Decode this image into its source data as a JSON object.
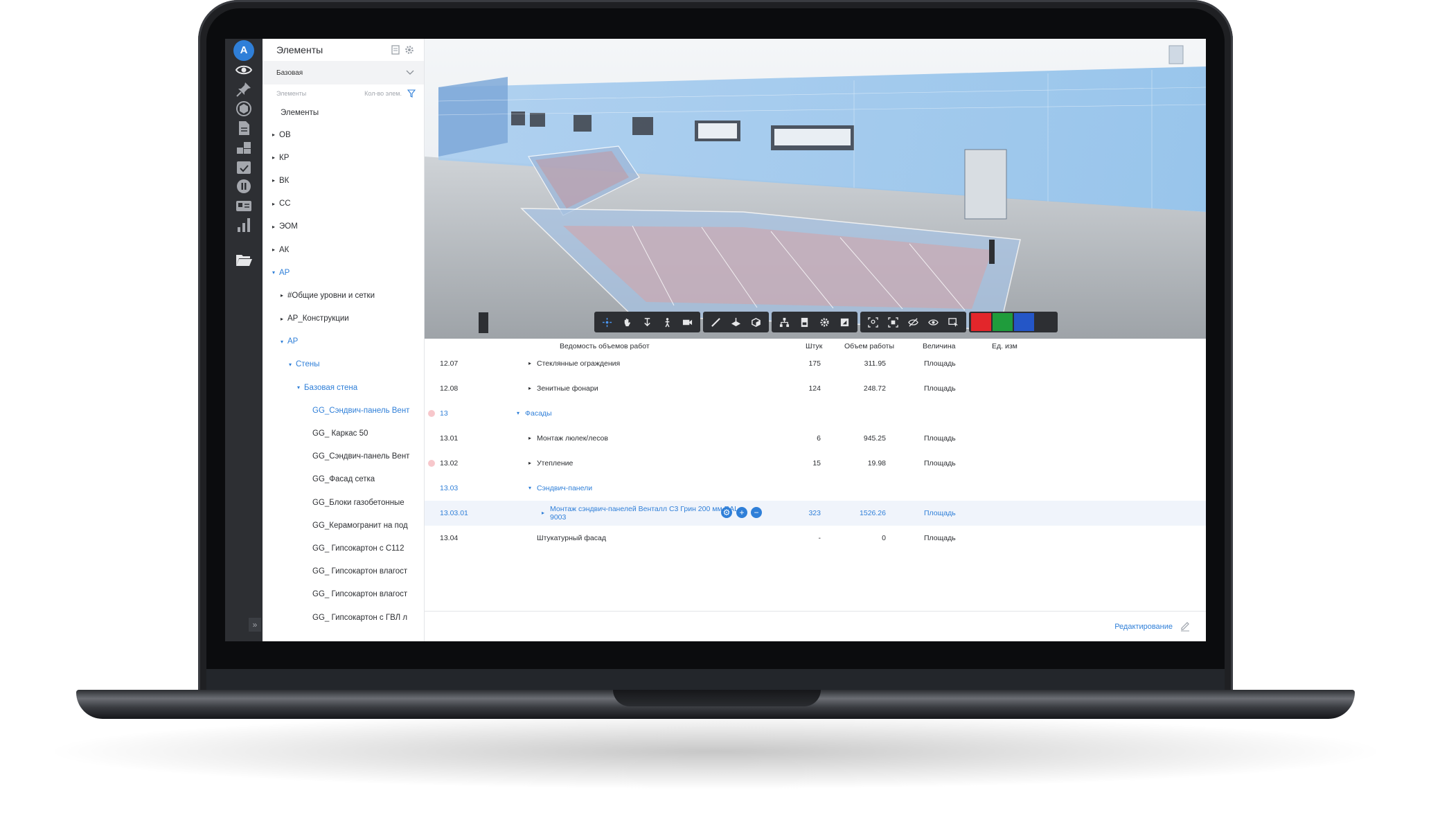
{
  "app": {
    "logo_letter": "A"
  },
  "rail": {
    "icons": [
      "eye-icon",
      "pin-icon",
      "cube-icon",
      "document-icon",
      "layers-icon",
      "calendar-icon",
      "pause-icon",
      "id-card-icon",
      "bar-chart-icon",
      "folder-icon"
    ],
    "expand_icon": "»"
  },
  "panel": {
    "title": "Элементы",
    "preset": "Базовая",
    "col_elements": "Элементы",
    "col_count": "Кол-во элем.",
    "root": "Элементы",
    "items": [
      {
        "label": "ОВ",
        "level": 0,
        "expanded": false,
        "selected": false
      },
      {
        "label": "КР",
        "level": 0,
        "expanded": false,
        "selected": false
      },
      {
        "label": "ВК",
        "level": 0,
        "expanded": false,
        "selected": false
      },
      {
        "label": "СС",
        "level": 0,
        "expanded": false,
        "selected": false
      },
      {
        "label": "ЭОМ",
        "level": 0,
        "expanded": false,
        "selected": false
      },
      {
        "label": "АК",
        "level": 0,
        "expanded": false,
        "selected": false
      },
      {
        "label": "АР",
        "level": 0,
        "expanded": true,
        "selected": true
      },
      {
        "label": "#Общие уровни и сетки",
        "level": 1,
        "expanded": false,
        "selected": false
      },
      {
        "label": "АР_Конструкции",
        "level": 1,
        "expanded": false,
        "selected": false
      },
      {
        "label": "АР",
        "level": 1,
        "expanded": true,
        "selected": true
      },
      {
        "label": "Стены",
        "level": 2,
        "expanded": true,
        "selected": true
      },
      {
        "label": "Базовая стена",
        "level": 3,
        "expanded": true,
        "selected": true
      },
      {
        "label": "GG_Сэндвич-панель Вент",
        "level": 4,
        "leaf": true,
        "selected": true
      },
      {
        "label": "GG_ Каркас 50",
        "level": 4,
        "leaf": true,
        "selected": false
      },
      {
        "label": "GG_Сэндвич-панель Вент",
        "level": 4,
        "leaf": true,
        "selected": false
      },
      {
        "label": "GG_Фасад сетка",
        "level": 4,
        "leaf": true,
        "selected": false
      },
      {
        "label": "GG_Блоки газобетонные",
        "level": 4,
        "leaf": true,
        "selected": false
      },
      {
        "label": "GG_Керамогранит на под",
        "level": 4,
        "leaf": true,
        "selected": false
      },
      {
        "label": "GG_ Гипсокартон с С112",
        "level": 4,
        "leaf": true,
        "selected": false
      },
      {
        "label": "GG_ Гипсокартон влагост",
        "level": 4,
        "leaf": true,
        "selected": false
      },
      {
        "label": "GG_ Гипсокартон влагост",
        "level": 4,
        "leaf": true,
        "selected": false
      },
      {
        "label": "GG_ Гипсокартон с ГВЛ л",
        "level": 4,
        "leaf": true,
        "selected": false
      }
    ]
  },
  "toolbar": {
    "groups": [
      [
        "orbit-icon",
        "pan-icon",
        "walk-down-icon",
        "person-icon",
        "camera-icon"
      ],
      [
        "measure-icon",
        "section-plane-icon",
        "section-box-icon"
      ],
      [
        "tree-icon",
        "file-icon",
        "settings-icon",
        "fullscreen-icon"
      ],
      [
        "zoom-area-icon",
        "focus-icon",
        "hide-icon",
        "show-icon",
        "select-icon"
      ]
    ],
    "colors": [
      "#e3262b",
      "#1f9c3c",
      "#2456c7",
      "#2d2f33"
    ]
  },
  "table": {
    "headers": {
      "name": "Ведомость объемов работ",
      "count": "Штук",
      "volume": "Объем работы",
      "quantity": "Величина",
      "unit": "Ед. изм"
    },
    "rows": [
      {
        "code": "12.07",
        "name": "Стеклянные ограждения",
        "count": "175",
        "volume": "311.95",
        "quantity": "Площадь",
        "indent": 2,
        "blue": false,
        "dot": false,
        "expanded": false
      },
      {
        "code": "12.08",
        "name": "Зенитные фонари",
        "count": "124",
        "volume": "248.72",
        "quantity": "Площадь",
        "indent": 2,
        "blue": false,
        "dot": false,
        "expanded": false
      },
      {
        "code": "13",
        "name": "Фасады",
        "count": "",
        "volume": "",
        "quantity": "",
        "indent": 1,
        "blue": true,
        "dot": true,
        "expanded": true
      },
      {
        "code": "13.01",
        "name": "Монтаж люлек/лесов",
        "count": "6",
        "volume": "945.25",
        "quantity": "Площадь",
        "indent": 2,
        "blue": false,
        "dot": false,
        "expanded": false
      },
      {
        "code": "13.02",
        "name": "Утепление",
        "count": "15",
        "volume": "19.98",
        "quantity": "Площадь",
        "indent": 2,
        "blue": false,
        "dot": true,
        "expanded": false
      },
      {
        "code": "13.03",
        "name": "Сэндвич-панели",
        "count": "",
        "volume": "",
        "quantity": "",
        "indent": 2,
        "blue": true,
        "dot": false,
        "expanded": true
      },
      {
        "code": "13.03.01",
        "name": "Монтаж сэндвич-панелей Венталл С3 Грин 200 мм RAL",
        "name2": "9003",
        "count": "323",
        "volume": "1526.26",
        "quantity": "Площадь",
        "indent": 3,
        "blue": true,
        "dot": false,
        "expanded": false,
        "selected": true
      },
      {
        "code": "13.04",
        "name": "Штукатурный фасад",
        "count": "-",
        "volume": "0",
        "quantity": "Площадь",
        "indent": 2,
        "blue": false,
        "dot": false,
        "expanded": false,
        "leaf": true
      }
    ],
    "edit_label": "Редактирование"
  }
}
